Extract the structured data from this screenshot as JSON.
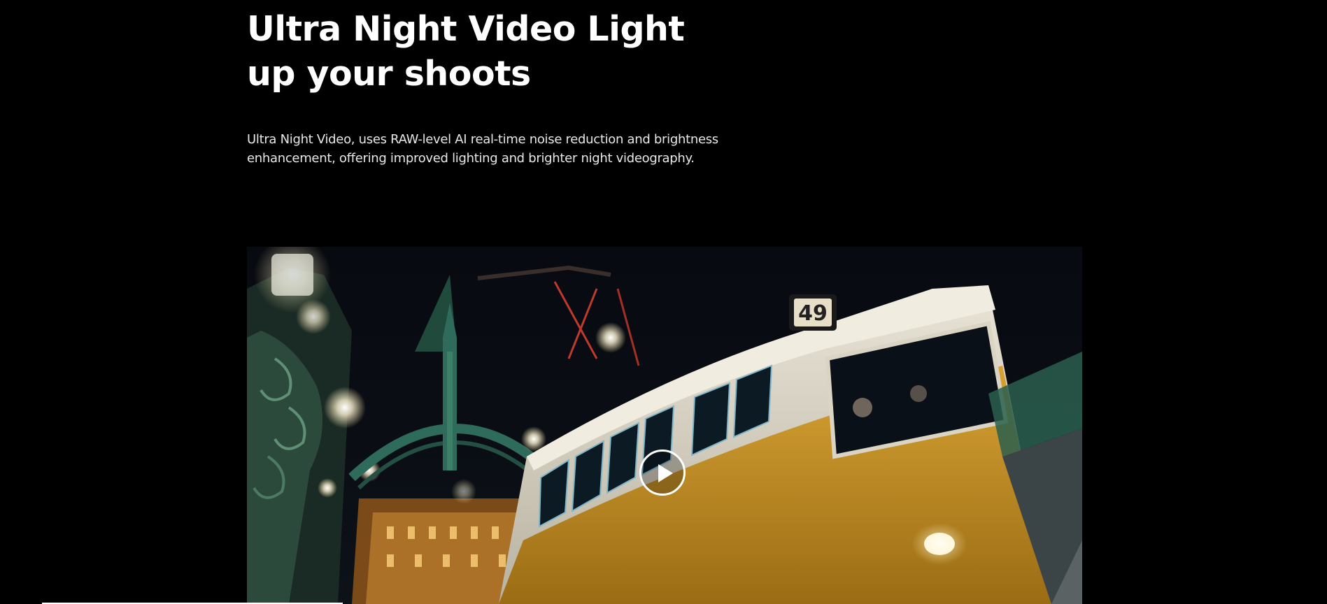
{
  "section": {
    "headline_line1": "Ultra Night Video Light",
    "headline_line2": "up your shoots",
    "description_line1": "Ultra Night Video, uses RAW-level AI real-time noise reduction and brightness",
    "description_line2": "enhancement, offering improved lighting and brighter night videography."
  },
  "video": {
    "tram_route_number": "49",
    "play_icon": "play-icon"
  },
  "colors": {
    "background": "#000000",
    "text": "#ffffff",
    "tram_yellow": "#c8921f",
    "bridge_green": "#2f6b5a"
  }
}
